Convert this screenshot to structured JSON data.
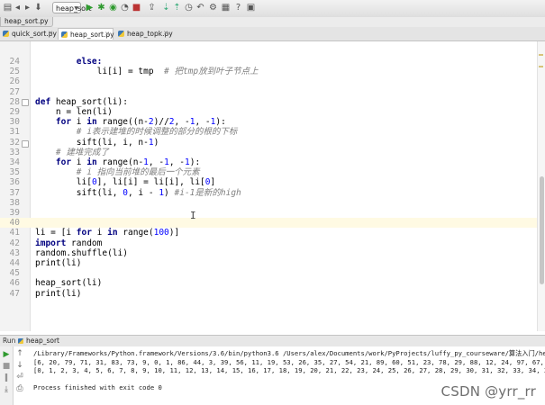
{
  "breadcrumb": "heap_sort.py",
  "toolbar": {
    "run_config": "heap_sort"
  },
  "tabs": [
    {
      "label": "quick_sort.py",
      "active": false
    },
    {
      "label": "heap_sort.py",
      "active": true
    },
    {
      "label": "heap_topk.py",
      "active": false
    }
  ],
  "editor": {
    "lines": [
      {
        "n": "24",
        "indent": "        ",
        "tokens": [
          {
            "t": "else:",
            "c": "kw"
          }
        ]
      },
      {
        "n": "25",
        "indent": "            ",
        "tokens": [
          {
            "t": "li[i] = tmp  ",
            "c": ""
          },
          {
            "t": "# 把tmp放到叶子节点上",
            "c": "cmt"
          }
        ]
      },
      {
        "n": "26",
        "indent": "",
        "tokens": []
      },
      {
        "n": "27",
        "indent": "",
        "tokens": []
      },
      {
        "n": "28",
        "indent": "",
        "tokens": [
          {
            "t": "def ",
            "c": "kw"
          },
          {
            "t": "heap_sort(li):",
            "c": ""
          }
        ]
      },
      {
        "n": "29",
        "indent": "    ",
        "tokens": [
          {
            "t": "n = len(li)",
            "c": ""
          }
        ]
      },
      {
        "n": "30",
        "indent": "    ",
        "tokens": [
          {
            "t": "for ",
            "c": "kw"
          },
          {
            "t": "i ",
            "c": ""
          },
          {
            "t": "in ",
            "c": "kw"
          },
          {
            "t": "range((n-",
            "c": ""
          },
          {
            "t": "2",
            "c": "num"
          },
          {
            "t": ")//",
            "c": ""
          },
          {
            "t": "2",
            "c": "num"
          },
          {
            "t": ", -",
            "c": ""
          },
          {
            "t": "1",
            "c": "num"
          },
          {
            "t": ", -",
            "c": ""
          },
          {
            "t": "1",
            "c": "num"
          },
          {
            "t": "):",
            "c": ""
          }
        ]
      },
      {
        "n": "31",
        "indent": "        ",
        "tokens": [
          {
            "t": "# i表示建堆的时候调整的部分的根的下标",
            "c": "cmt"
          }
        ]
      },
      {
        "n": "32",
        "indent": "        ",
        "tokens": [
          {
            "t": "sift(li, i, n-",
            "c": ""
          },
          {
            "t": "1",
            "c": "num"
          },
          {
            "t": ")",
            "c": ""
          }
        ]
      },
      {
        "n": "33",
        "indent": "    ",
        "tokens": [
          {
            "t": "# 建堆完成了",
            "c": "cmt"
          }
        ]
      },
      {
        "n": "34",
        "indent": "    ",
        "tokens": [
          {
            "t": "for ",
            "c": "kw"
          },
          {
            "t": "i ",
            "c": ""
          },
          {
            "t": "in ",
            "c": "kw"
          },
          {
            "t": "range(n-",
            "c": ""
          },
          {
            "t": "1",
            "c": "num"
          },
          {
            "t": ", -",
            "c": ""
          },
          {
            "t": "1",
            "c": "num"
          },
          {
            "t": ", -",
            "c": ""
          },
          {
            "t": "1",
            "c": "num"
          },
          {
            "t": "):",
            "c": ""
          }
        ]
      },
      {
        "n": "35",
        "indent": "        ",
        "tokens": [
          {
            "t": "# i 指向当前堆的最后一个元素",
            "c": "cmt"
          }
        ]
      },
      {
        "n": "36",
        "indent": "        ",
        "tokens": [
          {
            "t": "li[",
            "c": ""
          },
          {
            "t": "0",
            "c": "num"
          },
          {
            "t": "], li[i] = li[i], li[",
            "c": ""
          },
          {
            "t": "0",
            "c": "num"
          },
          {
            "t": "]",
            "c": ""
          }
        ]
      },
      {
        "n": "37",
        "indent": "        ",
        "tokens": [
          {
            "t": "sift(li, ",
            "c": ""
          },
          {
            "t": "0",
            "c": "num"
          },
          {
            "t": ", i - ",
            "c": ""
          },
          {
            "t": "1",
            "c": "num"
          },
          {
            "t": ") ",
            "c": ""
          },
          {
            "t": "#i-1是新的high",
            "c": "cmt"
          }
        ]
      },
      {
        "n": "38",
        "indent": "",
        "tokens": []
      },
      {
        "n": "39",
        "indent": "",
        "tokens": []
      },
      {
        "n": "40",
        "indent": "",
        "tokens": []
      },
      {
        "n": "41",
        "indent": "",
        "tokens": [
          {
            "t": "li = [i ",
            "c": ""
          },
          {
            "t": "for ",
            "c": "kw"
          },
          {
            "t": "i ",
            "c": ""
          },
          {
            "t": "in ",
            "c": "kw"
          },
          {
            "t": "range(",
            "c": ""
          },
          {
            "t": "100",
            "c": "num"
          },
          {
            "t": ")]",
            "c": ""
          }
        ]
      },
      {
        "n": "42",
        "indent": "",
        "tokens": [
          {
            "t": "import ",
            "c": "kw"
          },
          {
            "t": "random",
            "c": ""
          }
        ]
      },
      {
        "n": "43",
        "indent": "",
        "tokens": [
          {
            "t": "random.shuffle(li)",
            "c": ""
          }
        ]
      },
      {
        "n": "44",
        "indent": "",
        "tokens": [
          {
            "t": "print(li)",
            "c": ""
          }
        ]
      },
      {
        "n": "45",
        "indent": "",
        "tokens": []
      },
      {
        "n": "46",
        "indent": "",
        "tokens": [
          {
            "t": "heap_sort(li)",
            "c": ""
          }
        ]
      },
      {
        "n": "47",
        "indent": "",
        "tokens": [
          {
            "t": "print(li)",
            "c": ""
          }
        ]
      }
    ]
  },
  "run_panel": {
    "label": "Run",
    "tab_label": "heap_sort",
    "output": [
      "/Library/Frameworks/Python.framework/Versions/3.6/bin/python3.6 /Users/alex/Documents/work/PyProjects/luffy_py_courseware/算法入门/heap_sort.py",
      "[6, 20, 79, 71, 31, 83, 73, 9, 0, 1, 86, 44, 3, 39, 56, 11, 19, 53, 26, 35, 27, 54, 21, 89, 60, 51, 23, 78, 29, 88, 12, 24, 97, 67, 81, 85, 91, 58, 96,",
      "[0, 1, 2, 3, 4, 5, 6, 7, 8, 9, 10, 11, 12, 13, 14, 15, 16, 17, 18, 19, 20, 21, 22, 23, 24, 25, 26, 27, 28, 29, 30, 31, 32, 33, 34, 35, 36, 37, 38, 39, 4",
      "",
      "Process finished with exit code 0"
    ]
  },
  "watermark": "CSDN @yrr_rr"
}
